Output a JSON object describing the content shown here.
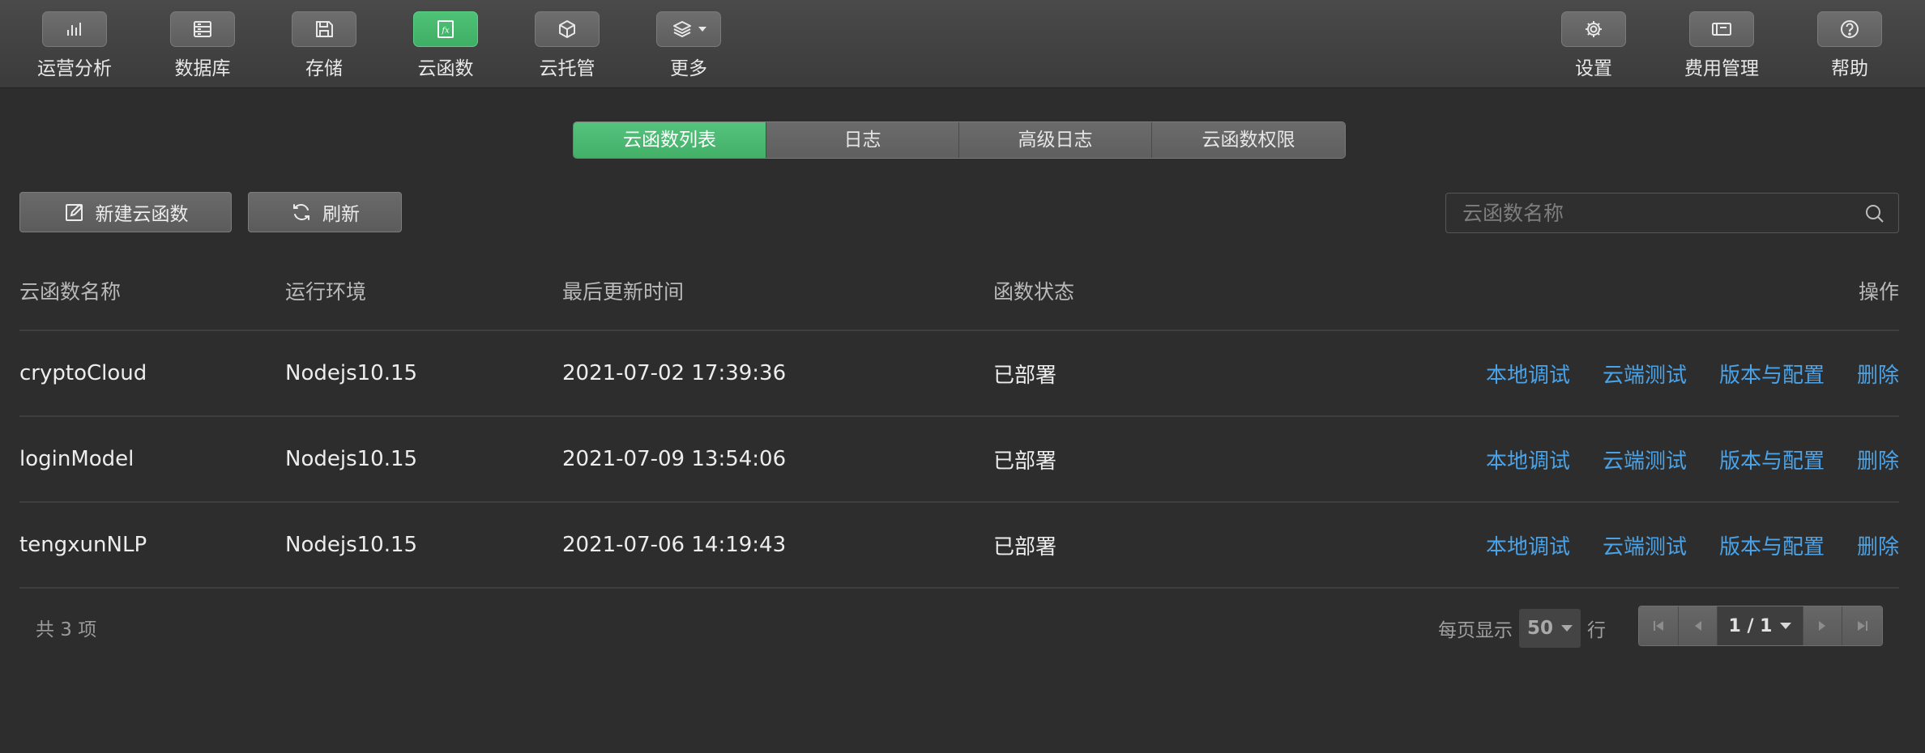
{
  "toolbar": {
    "left_items": [
      {
        "label": "运营分析",
        "icon": "bar-chart-icon"
      },
      {
        "label": "数据库",
        "icon": "database-icon"
      },
      {
        "label": "存储",
        "icon": "save-icon"
      },
      {
        "label": "云函数",
        "icon": "function-icon",
        "active": true
      },
      {
        "label": "云托管",
        "icon": "cube-icon"
      },
      {
        "label": "更多",
        "icon": "layers-icon"
      }
    ],
    "right_items": [
      {
        "label": "设置",
        "icon": "gear-icon"
      },
      {
        "label": "费用管理",
        "icon": "card-icon"
      },
      {
        "label": "帮助",
        "icon": "help-icon"
      }
    ]
  },
  "tabs": [
    "云函数列表",
    "日志",
    "高级日志",
    "云函数权限"
  ],
  "active_tab": "云函数列表",
  "actions": {
    "new_label": "新建云函数",
    "refresh_label": "刷新"
  },
  "search": {
    "placeholder": "云函数名称"
  },
  "table": {
    "headers": {
      "name": "云函数名称",
      "env": "运行环境",
      "time": "最后更新时间",
      "status": "函数状态",
      "ops": "操作"
    },
    "rows": [
      {
        "name": "cryptoCloud",
        "env": "Nodejs10.15",
        "time": "2021-07-02 17:39:36",
        "status": "已部署"
      },
      {
        "name": "loginModel",
        "env": "Nodejs10.15",
        "time": "2021-07-09 13:54:06",
        "status": "已部署"
      },
      {
        "name": "tengxunNLP",
        "env": "Nodejs10.15",
        "time": "2021-07-06 14:19:43",
        "status": "已部署"
      }
    ],
    "row_actions": {
      "local_debug": "本地调试",
      "cloud_test": "云端测试",
      "version_config": "版本与配置",
      "delete": "删除"
    }
  },
  "footer": {
    "total": "共 3 项",
    "per_page_prefix": "每页显示",
    "per_page_value": "50",
    "per_page_suffix": "行",
    "page": "1 / 1"
  },
  "colors": {
    "accent_green": "#4cbb73",
    "link_blue": "#4aa3e8",
    "background": "#2d2d2d"
  }
}
